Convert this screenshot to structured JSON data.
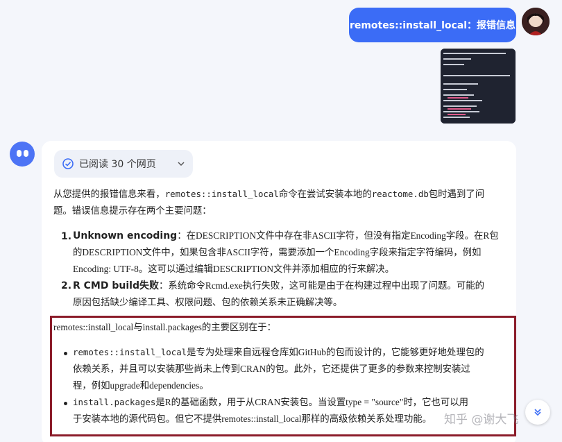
{
  "user_message": "remotes::install_local：报错信息",
  "pages_chip": {
    "label": "已阅读 30 个网页"
  },
  "intro": {
    "line1_pre": "从您提供的报错信息来看，",
    "line1_code": "remotes::install_local",
    "line1_mid": "命令在尝试安装本地的",
    "line1_code2": "reactome.db",
    "line1_post": "包时遇到了问",
    "line2": "题。错误信息提示存在两个主要问题："
  },
  "issues": [
    {
      "num": "1.",
      "title": "Unknown encoding",
      "l1": "：在DESCRIPTION文件中存在非ASCII字符，但没有指定Encoding字段。在R包",
      "l2": "的DESCRIPTION文件中，如果包含非ASCII字符，需要添加一个Encoding字段来指定字符编码，例如",
      "l3": "Encoding: UTF-8。这可以通过编辑DESCRIPTION文件并添加相应的行来解决。"
    },
    {
      "num": "2.",
      "title": "R CMD build失败",
      "l1": "：系统命令Rcmd.exe执行失败，这可能是由于在构建过程中出现了问题。可能的",
      "l2": "原因包括缺少编译工具、权限问题、包的依赖关系未正确解决等。"
    }
  ],
  "diff": {
    "heading": "remotes::install_local与install.packages的主要区别在于：",
    "b1_l1_code": "remotes::install_local",
    "b1_l1": "是专为处理来自远程仓库如GitHub的包而设计的，它能够更好地处理包的",
    "b1_l2": "依赖关系，并且可以安装那些尚未上传到CRAN的包。此外，它还提供了更多的参数来控制安装过",
    "b1_l3": "程，例如upgrade和dependencies。",
    "b2_l1_code": "install.packages",
    "b2_l1": "是R的基础函数，用于从CRAN安装包。当设置type = \"source\"时，它也可以用",
    "b2_l2": "于安装本地的源代码包。但它不提供remotes::install_local那样的高级依赖关系处理功能。"
  },
  "watermark": "知乎 @谢大飞",
  "colors": {
    "accent": "#3b6cf6",
    "highlight_border": "#8b1c2a"
  }
}
